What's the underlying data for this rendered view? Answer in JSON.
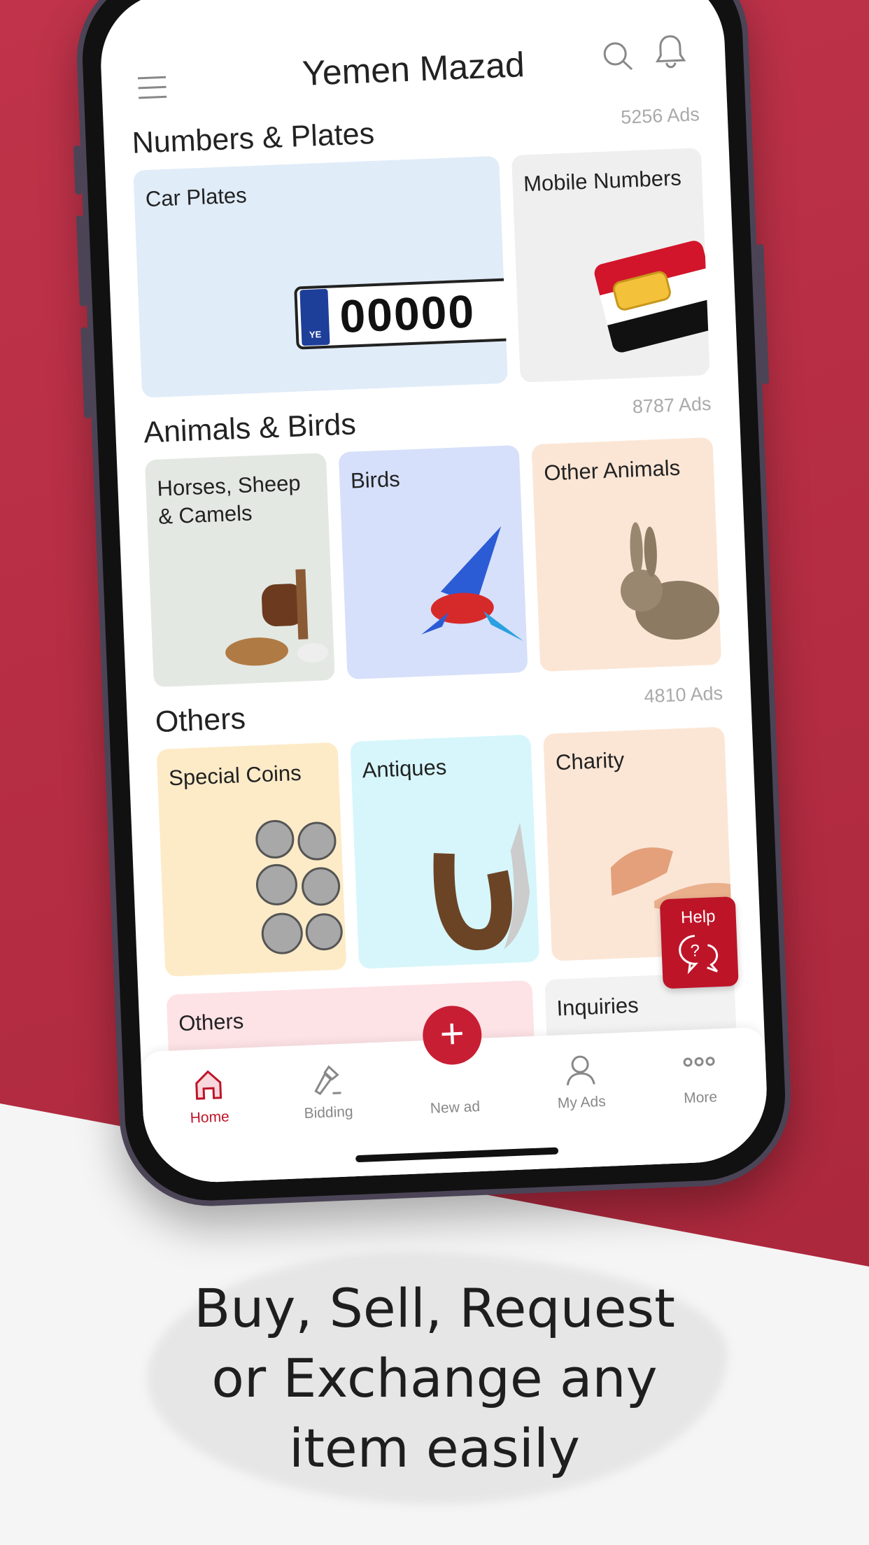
{
  "app": {
    "title": "Yemen Mazad"
  },
  "header": {
    "menu_icon": "hamburger-icon",
    "search_icon": "search-icon",
    "notification_icon": "bell-icon"
  },
  "sections": [
    {
      "title": "Numbers & Plates",
      "count": "5256 Ads",
      "cards": [
        {
          "label": "Car Plates",
          "color": "#e0ecf8",
          "plate_text": "00000",
          "plate_flag": "YE"
        },
        {
          "label": "Mobile Numbers",
          "color": "#efefef"
        }
      ]
    },
    {
      "title": "Animals & Birds",
      "count": "8787 Ads",
      "cards": [
        {
          "label": "Horses, Sheep & Camels",
          "color": "#e4e8e2"
        },
        {
          "label": "Birds",
          "color": "#d6e0fa"
        },
        {
          "label": "Other Animals",
          "color": "#fbe6d6"
        }
      ]
    },
    {
      "title": "Others",
      "count": "4810 Ads",
      "cards": [
        {
          "label": "Special Coins",
          "color": "#fdebc8"
        },
        {
          "label": "Antiques",
          "color": "#d6f6fb"
        },
        {
          "label": "Charity",
          "color": "#fbe6d6"
        }
      ]
    },
    {
      "cards": [
        {
          "label": "Others",
          "color": "#fde2e6"
        },
        {
          "label": "Inquiries",
          "color": "#f2f2f2"
        }
      ]
    }
  ],
  "help": {
    "label": "Help",
    "icon": "help-chat-icon"
  },
  "tabbar": {
    "items": [
      {
        "label": "Home",
        "icon": "home-icon",
        "active": true
      },
      {
        "label": "Bidding",
        "icon": "gavel-icon"
      },
      {
        "label": "New ad",
        "icon": "plus-icon"
      },
      {
        "label": "My Ads",
        "icon": "user-icon"
      },
      {
        "label": "More",
        "icon": "more-dots-icon"
      }
    ],
    "fab_symbol": "+"
  },
  "tagline": [
    "Buy, Sell, Request",
    "or Exchange any",
    "item easily"
  ],
  "colors": {
    "brand": "#be1428",
    "background": "#b52e3e",
    "active_tab": "#be1428"
  }
}
